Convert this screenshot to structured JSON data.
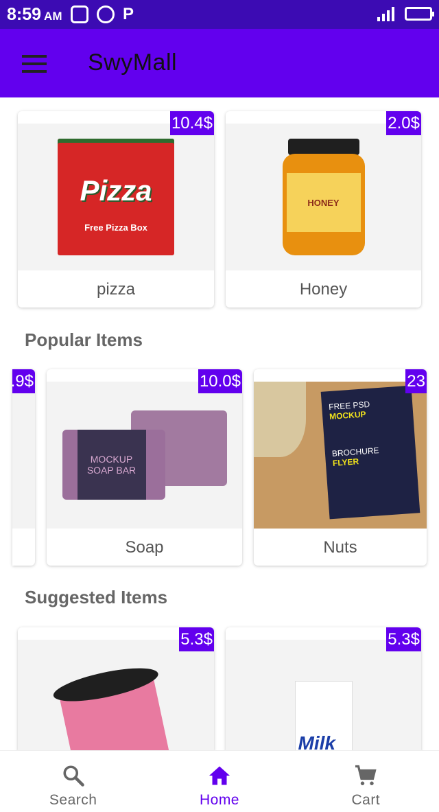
{
  "status": {
    "time": "8:59",
    "ampm": "AM"
  },
  "app": {
    "title": "SwyMall"
  },
  "top_products": [
    {
      "name": "pizza",
      "price": "10.4$"
    },
    {
      "name": "Honey",
      "price": "2.0$"
    }
  ],
  "popular": {
    "title": "Popular Items",
    "partial_price": ".9$",
    "items": [
      {
        "name": "Soap",
        "price": "10.0$"
      },
      {
        "name": "Nuts",
        "price": "23"
      }
    ]
  },
  "suggested": {
    "title": "Suggested Items",
    "items": [
      {
        "price": "5.3$"
      },
      {
        "price": "5.3$"
      }
    ]
  },
  "product_art": {
    "pizza_box": {
      "title": "Pizza",
      "subtitle": "Free Pizza Box"
    },
    "honey_label": "HONEY",
    "soap_band": "MOCKUP SOAP BAR",
    "brochure": {
      "line1": "FREE PSD",
      "line2": "MOCKUP",
      "line3": "BROCHURE",
      "line4": "FLYER"
    },
    "milk_label": "Milk"
  },
  "nav": {
    "search": "Search",
    "home": "Home",
    "cart": "Cart",
    "active": "home"
  },
  "colors": {
    "primary": "#6200ee",
    "status_bar": "#3c0bb3"
  }
}
